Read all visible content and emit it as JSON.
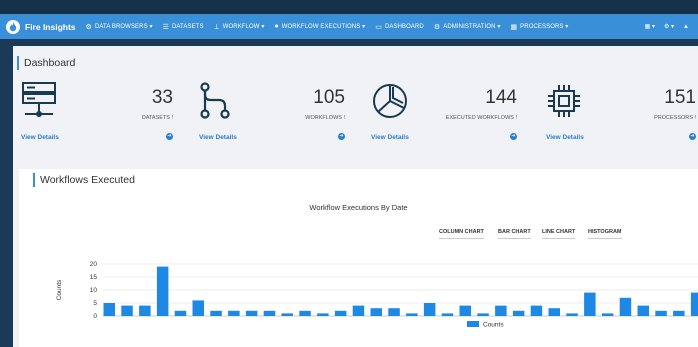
{
  "app": {
    "name": "Fire Insights"
  },
  "nav": {
    "items": [
      {
        "icon": "⚙",
        "icon_name": "data-browsers-icon",
        "label": "DATA BROWSERS ▾"
      },
      {
        "icon": "☰",
        "icon_name": "datasets-icon",
        "label": "DATASETS"
      },
      {
        "icon": "⊥",
        "icon_name": "workflow-icon",
        "label": "WORKFLOW ▾"
      },
      {
        "icon": "●",
        "icon_name": "workflow-executions-icon",
        "label": "WORKFLOW EXECUTIONS ▾"
      },
      {
        "icon": "▭",
        "icon_name": "dashboard-icon",
        "label": "DASHBOARD"
      },
      {
        "icon": "⚙",
        "icon_name": "administration-icon",
        "label": "ADMINISTRATION ▾"
      },
      {
        "icon": "▦",
        "icon_name": "processors-icon",
        "label": "PROCESSORS ▾"
      }
    ],
    "right": [
      "▦ ▾",
      "⚙ ▾",
      "▲"
    ]
  },
  "dashboard": {
    "title": "Dashboard",
    "stats": [
      {
        "number": "33",
        "label": "DATASETS !",
        "link": "View Details",
        "icon": "server-icon"
      },
      {
        "number": "105",
        "label": "WORKFLOWS !",
        "link": "View Details",
        "icon": "workflow-graph-icon"
      },
      {
        "number": "144",
        "label": "EXECUTED WORKFLOWS !",
        "link": "View Details",
        "icon": "pie-chart-icon"
      },
      {
        "number": "151",
        "label": "PROCESSORS !",
        "link": "View Details",
        "icon": "chip-icon"
      }
    ]
  },
  "panel": {
    "title": "Workflows Executed",
    "chart_title": "Workflow Executions By Date",
    "buttons": [
      "COLUMN CHART",
      "BAR CHART",
      "LINE CHART",
      "HISTOGRAM"
    ]
  },
  "chart_data": {
    "type": "bar",
    "title": "Workflow Executions By Date",
    "xlabel": "",
    "ylabel": "Counts",
    "ylim": [
      0,
      20
    ],
    "yticks": [
      0,
      5,
      10,
      15,
      20
    ],
    "grid": true,
    "legend": "bottom-center",
    "color": "#1e88e5",
    "series": [
      {
        "name": "Counts",
        "values": [
          5,
          4,
          4,
          19,
          2,
          6,
          2,
          2,
          2,
          2,
          1,
          2,
          1,
          2,
          4,
          3,
          3,
          1,
          5,
          1,
          4,
          1,
          4,
          2,
          4,
          3,
          1,
          9,
          1,
          7,
          4,
          2,
          2,
          9
        ]
      }
    ]
  }
}
